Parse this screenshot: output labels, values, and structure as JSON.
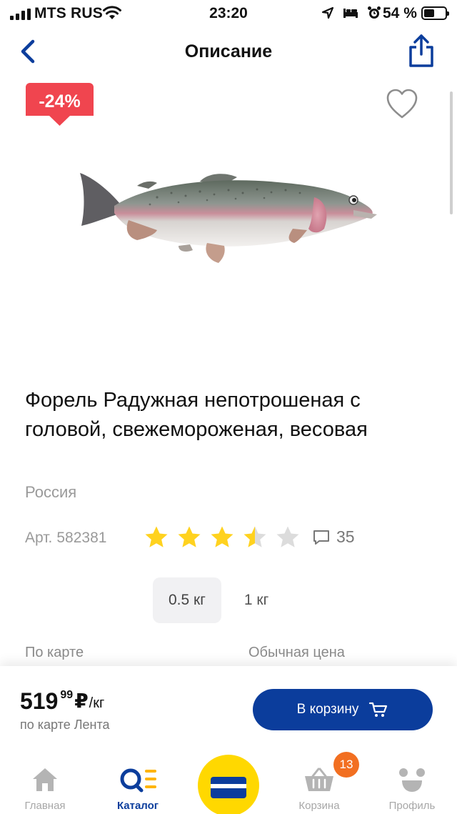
{
  "status_bar": {
    "carrier": "MTS RUS",
    "time": "23:20",
    "battery": "54 %"
  },
  "navbar": {
    "title": "Описание"
  },
  "product": {
    "discount": "-24%",
    "title": "Форель Радужная непотрошеная с головой, свежемороженая, весовая",
    "country": "Россия",
    "article_label": "Арт.",
    "article_value": "582381",
    "rating": 3.5,
    "rating_max": 5,
    "reviews_count": "35",
    "weights": [
      {
        "label": "0.5 кг",
        "selected": true
      },
      {
        "label": "1 кг",
        "selected": false
      }
    ],
    "price_label_card": "По карте",
    "price_label_regular": "Обычная цена"
  },
  "price_panel": {
    "price_rub": "519",
    "price_kop": "99",
    "currency": "₽",
    "unit": "/кг",
    "note": "по карте Лента",
    "cart_button": "В корзину"
  },
  "tabbar": {
    "items": [
      {
        "label": "Главная",
        "icon": "home-icon",
        "active": false
      },
      {
        "label": "Каталог",
        "icon": "catalog-search-icon",
        "active": true
      },
      {
        "label": "Корзина",
        "icon": "basket-icon",
        "active": false,
        "badge": "13"
      },
      {
        "label": "Профиль",
        "icon": "profile-smile-icon",
        "active": false
      }
    ]
  },
  "colors": {
    "primary": "#0b3d9c",
    "accent_yellow": "#ffd800",
    "discount_red": "#f0454f",
    "star": "#ffd21f",
    "badge_orange": "#f26f21"
  }
}
